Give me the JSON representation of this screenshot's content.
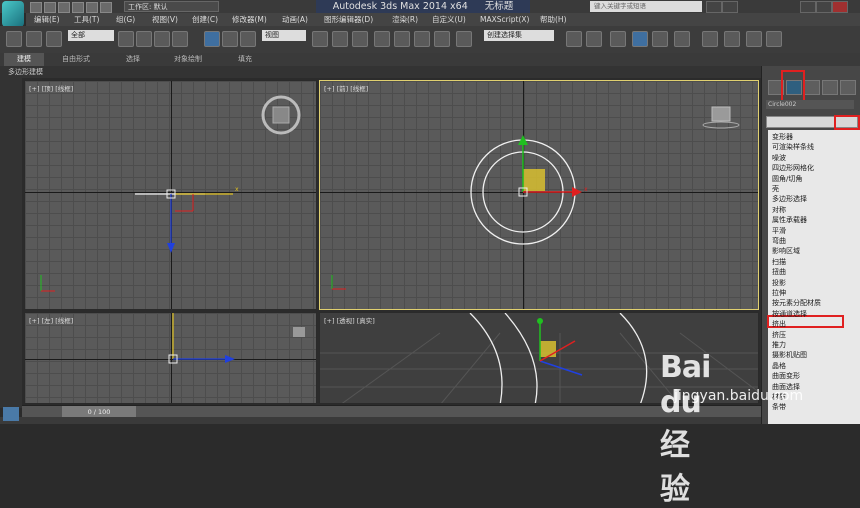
{
  "window": {
    "app_title": "Autodesk 3ds Max  2014 x64",
    "doc_title": "无标题",
    "workspace": "工作区: 默认",
    "search_placeholder": "键入关键字或短语"
  },
  "menubar": [
    "编辑(E)",
    "工具(T)",
    "组(G)",
    "视图(V)",
    "创建(C)",
    "修改器(M)",
    "动画(A)",
    "图形编辑器(D)",
    "渲染(R)",
    "自定义(U)",
    "MAXScript(X)",
    "帮助(H)"
  ],
  "toolbar": {
    "selection_filter": "全部",
    "ref_coord": "视图",
    "named_selection": "创建选择集"
  },
  "ribbon": {
    "tabs": [
      "建模",
      "自由形式",
      "选择",
      "对象绘制",
      "填充"
    ],
    "sub_label": "多边形建模"
  },
  "viewports": {
    "top": "[+] [顶] [线框]",
    "front": "[+] [前] [线框]",
    "left": "[+] [左] [线框]",
    "persp": "[+] [透视] [真实]"
  },
  "command_panel": {
    "object_name": "Circle002",
    "modifiers": [
      "变形器",
      "可渲染样条线",
      "噪波",
      "四边形网格化",
      "圆角/切角",
      "壳",
      "多边形选择",
      "对称",
      "属性承载器",
      "平滑",
      "弯曲",
      "影响区域",
      "扫描",
      "扭曲",
      "投影",
      "拉伸",
      "按元素分配材质",
      "按通道选择",
      "挤出",
      "挤压",
      "推力",
      "摄影机贴图",
      "晶格",
      "曲面变形",
      "曲面选择",
      "材质",
      "条带"
    ]
  },
  "timeline": {
    "frame": "0 / 100"
  },
  "watermark": {
    "logo": "Bai du 经验",
    "url": "jingyan.baidu.com"
  },
  "colors": {
    "highlight_red": "#e02020",
    "active_viewport_border": "#e0d070",
    "x_axis": "#e02020",
    "y_axis": "#20c020",
    "z_axis": "#2040e0"
  }
}
